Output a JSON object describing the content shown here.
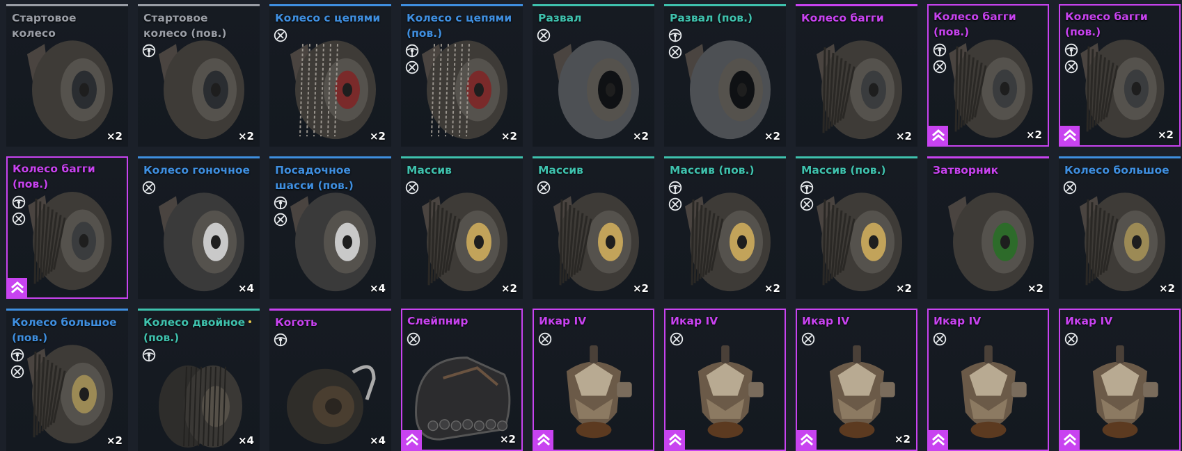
{
  "colors": {
    "common": "#9a9ea6",
    "rare": "#3f8fe0",
    "special": "#3fc2ae",
    "epic": "#c843f0",
    "background": "#1b2029"
  },
  "cards": [
    {
      "title": "Стартовое колесо",
      "rarity": "common",
      "count": "×2",
      "icons": [],
      "selected": false,
      "rank": false,
      "art": "wheel-plain"
    },
    {
      "title": "Стартовое колесо (пов.)",
      "rarity": "common",
      "count": "×2",
      "icons": [
        "steering-icon"
      ],
      "selected": false,
      "rank": false,
      "art": "wheel-plain"
    },
    {
      "title": "Колесо с цепями",
      "rarity": "rare",
      "count": "×2",
      "icons": [
        "no-steering-icon"
      ],
      "selected": false,
      "rank": false,
      "art": "wheel-chains"
    },
    {
      "title": "Колесо с цепями (пов.)",
      "rarity": "rare",
      "count": "×2",
      "icons": [
        "steering-icon",
        "no-steering-icon"
      ],
      "selected": false,
      "rank": false,
      "art": "wheel-chains"
    },
    {
      "title": "Развал",
      "rarity": "special",
      "count": "×2",
      "icons": [
        "no-steering-icon"
      ],
      "selected": false,
      "rank": false,
      "art": "wheel-dark"
    },
    {
      "title": "Развал (пов.)",
      "rarity": "special",
      "count": "×2",
      "icons": [
        "steering-icon",
        "no-steering-icon"
      ],
      "selected": false,
      "rank": false,
      "art": "wheel-dark"
    },
    {
      "title": "Колесо багги",
      "rarity": "epic",
      "count": "×2",
      "icons": [],
      "selected": false,
      "rank": false,
      "art": "wheel-buggy"
    },
    {
      "title": "Колесо багги (пов.)",
      "rarity": "epic",
      "count": "×2",
      "icons": [
        "steering-icon",
        "no-steering-icon"
      ],
      "selected": true,
      "rank": true,
      "art": "wheel-buggy"
    },
    {
      "title": "Колесо багги (пов.)",
      "rarity": "epic",
      "count": "×2",
      "icons": [
        "steering-icon",
        "no-steering-icon"
      ],
      "selected": true,
      "rank": true,
      "art": "wheel-buggy"
    },
    {
      "title": "Колесо багги (пов.)",
      "rarity": "epic",
      "count": "",
      "icons": [
        "steering-icon",
        "no-steering-icon"
      ],
      "selected": true,
      "rank": true,
      "art": "wheel-buggy"
    },
    {
      "title": "Колесо гоночное",
      "rarity": "rare",
      "count": "×4",
      "icons": [
        "no-steering-icon"
      ],
      "selected": false,
      "rank": false,
      "art": "wheel-race"
    },
    {
      "title": "Посадочное шасси (пов.)",
      "rarity": "rare",
      "count": "×4",
      "icons": [
        "steering-icon",
        "no-steering-icon"
      ],
      "selected": false,
      "rank": false,
      "art": "wheel-race"
    },
    {
      "title": "Массив",
      "rarity": "special",
      "count": "×2",
      "icons": [
        "no-steering-icon"
      ],
      "selected": false,
      "rank": false,
      "art": "wheel-massive"
    },
    {
      "title": "Массив",
      "rarity": "special",
      "count": "×2",
      "icons": [
        "no-steering-icon"
      ],
      "selected": false,
      "rank": false,
      "art": "wheel-massive"
    },
    {
      "title": "Массив (пов.)",
      "rarity": "special",
      "count": "×2",
      "icons": [
        "steering-icon",
        "no-steering-icon"
      ],
      "selected": false,
      "rank": false,
      "art": "wheel-massive"
    },
    {
      "title": "Массив (пов.)",
      "rarity": "special",
      "count": "×2",
      "icons": [
        "steering-icon",
        "no-steering-icon"
      ],
      "selected": false,
      "rank": false,
      "art": "wheel-massive"
    },
    {
      "title": "Затворник",
      "rarity": "epic",
      "count": "×2",
      "icons": [],
      "selected": false,
      "rank": false,
      "art": "wheel-hermit"
    },
    {
      "title": "Колесо большое",
      "rarity": "rare",
      "count": "×2",
      "icons": [
        "no-steering-icon"
      ],
      "selected": false,
      "rank": false,
      "art": "wheel-big"
    },
    {
      "title": "Колесо большое (пов.)",
      "rarity": "rare",
      "count": "×2",
      "icons": [
        "steering-icon",
        "no-steering-icon"
      ],
      "selected": false,
      "rank": false,
      "art": "wheel-big"
    },
    {
      "title": "Колесо двойное (пов.)",
      "rarity": "special",
      "count": "×4",
      "icons": [
        "steering-icon"
      ],
      "selected": false,
      "rank": false,
      "art": "wheel-double",
      "dot": true
    },
    {
      "title": "Коготь",
      "rarity": "epic",
      "count": "×4",
      "icons": [
        "steering-icon"
      ],
      "selected": false,
      "rank": false,
      "art": "wheel-claw"
    },
    {
      "title": "Слейпнир",
      "rarity": "epic",
      "count": "×2",
      "icons": [
        "no-steering-icon"
      ],
      "selected": true,
      "rank": true,
      "art": "track"
    },
    {
      "title": "Икар IV",
      "rarity": "epic",
      "count": "",
      "icons": [
        "no-steering-icon"
      ],
      "selected": true,
      "rank": true,
      "art": "hover"
    },
    {
      "title": "Икар IV",
      "rarity": "epic",
      "count": "",
      "icons": [
        "no-steering-icon"
      ],
      "selected": true,
      "rank": true,
      "art": "hover"
    },
    {
      "title": "Икар IV",
      "rarity": "epic",
      "count": "×2",
      "icons": [
        "no-steering-icon"
      ],
      "selected": true,
      "rank": true,
      "art": "hover"
    },
    {
      "title": "Икар IV",
      "rarity": "epic",
      "count": "",
      "icons": [
        "no-steering-icon"
      ],
      "selected": true,
      "rank": true,
      "art": "hover"
    },
    {
      "title": "Икар IV",
      "rarity": "epic",
      "count": "",
      "icons": [
        "no-steering-icon"
      ],
      "selected": true,
      "rank": true,
      "art": "hover"
    }
  ]
}
